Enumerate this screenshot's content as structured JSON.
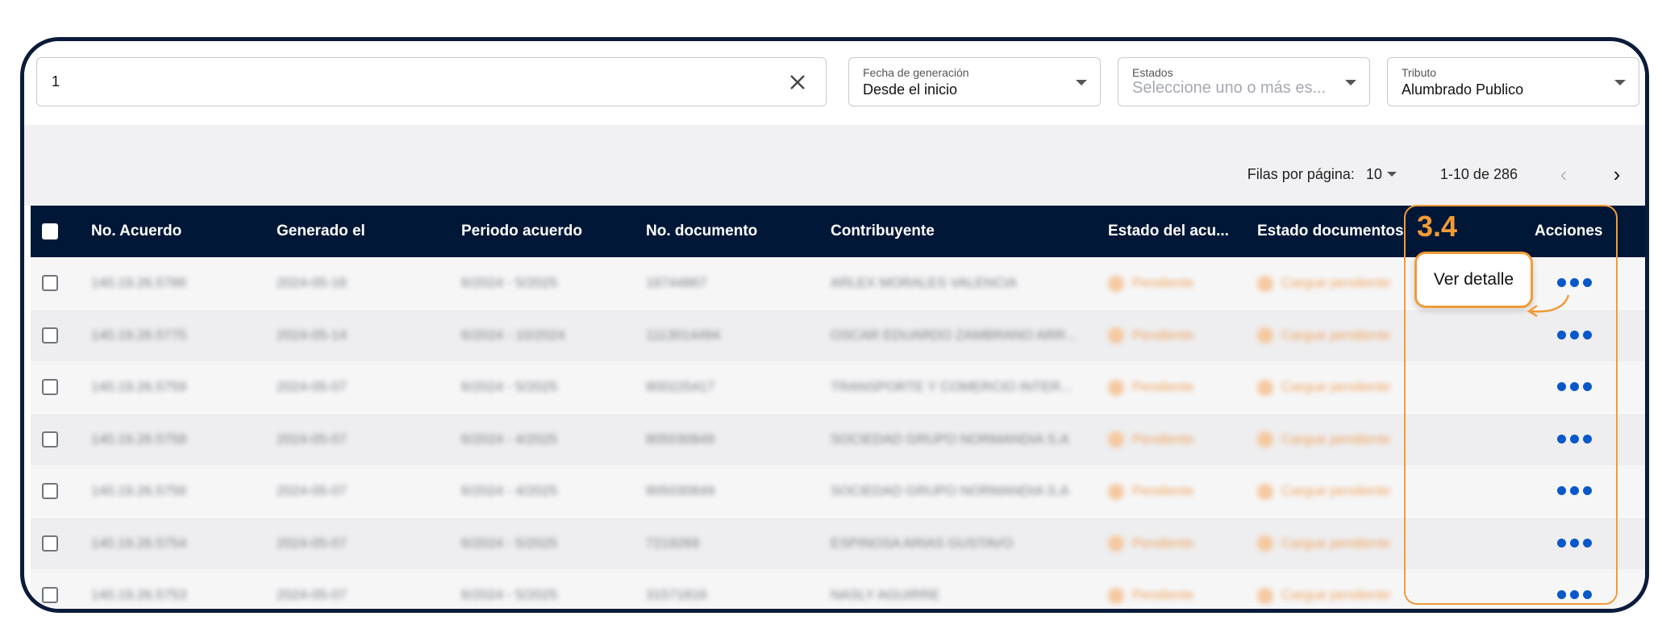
{
  "filters": {
    "search_value": "1",
    "fecha": {
      "label": "Fecha de generación",
      "value": "Desde el inicio"
    },
    "estados": {
      "label": "Estados",
      "placeholder": "Seleccione uno o más es..."
    },
    "tributo": {
      "label": "Tributo",
      "value": "Alumbrado Publico"
    }
  },
  "pager": {
    "rows_label": "Filas por página:",
    "rows_value": "10",
    "range": "1-10 de 286",
    "prev": "‹",
    "next": "›"
  },
  "table": {
    "headers": {
      "no_acuerdo": "No. Acuerdo",
      "generado_el": "Generado el",
      "periodo": "Periodo acuerdo",
      "no_documento": "No. documento",
      "contribuyente": "Contribuyente",
      "estado_acuerdo": "Estado del acu...",
      "estado_documentos": "Estado documentos",
      "acciones": "Acciones"
    },
    "rows": [
      {
        "no_acuerdo": "140.19.26.5786",
        "generado": "2024-05-16",
        "periodo": "6/2024 - 5/2025",
        "documento": "16744867",
        "contribuyente": "ARLEX MORALES VALENCIA",
        "estado": "Pendiente",
        "docs": "Cargue pendiente"
      },
      {
        "no_acuerdo": "140.19.26.5775",
        "generado": "2024-05-14",
        "periodo": "6/2024 - 10/2024",
        "documento": "1113014494",
        "contribuyente": "OSCAR EDUARDO ZAMBRANO ARR...",
        "estado": "Pendiente",
        "docs": "Cargue pendiente"
      },
      {
        "no_acuerdo": "140.19.26.5759",
        "generado": "2024-05-07",
        "periodo": "6/2024 - 5/2025",
        "documento": "800225417",
        "contribuyente": "TRANSPORTE Y COMERCIO INTER...",
        "estado": "Pendiente",
        "docs": "Cargue pendiente"
      },
      {
        "no_acuerdo": "140.19.26.5758",
        "generado": "2024-05-07",
        "periodo": "6/2024 - 4/2025",
        "documento": "805030849",
        "contribuyente": "SOCIEDAD GRUPO NORMANDIA S.A",
        "estado": "Pendiente",
        "docs": "Cargue pendiente"
      },
      {
        "no_acuerdo": "140.19.26.5756",
        "generado": "2024-05-07",
        "periodo": "6/2024 - 4/2025",
        "documento": "805030849",
        "contribuyente": "SOCIEDAD GRUPO NORMANDIA S.A",
        "estado": "Pendiente",
        "docs": "Cargue pendiente"
      },
      {
        "no_acuerdo": "140.19.26.5754",
        "generado": "2024-05-07",
        "periodo": "6/2024 - 5/2025",
        "documento": "7219269",
        "contribuyente": "ESPINOSA ARIAS GUSTAVO",
        "estado": "Pendiente",
        "docs": "Cargue pendiente"
      },
      {
        "no_acuerdo": "140.19.26.5753",
        "generado": "2024-05-07",
        "periodo": "6/2024 - 5/2025",
        "documento": "31571816",
        "contribuyente": "NASLY AGUIRRE",
        "estado": "Pendiente",
        "docs": "Cargue pendiente"
      }
    ]
  },
  "annotation": {
    "step": "3.4",
    "tooltip": "Ver detalle"
  },
  "colors": {
    "header_bg": "#001737",
    "frame_border": "#0b1b3a",
    "accent_orange": "#f29b38",
    "action_blue": "#0a57c9"
  }
}
